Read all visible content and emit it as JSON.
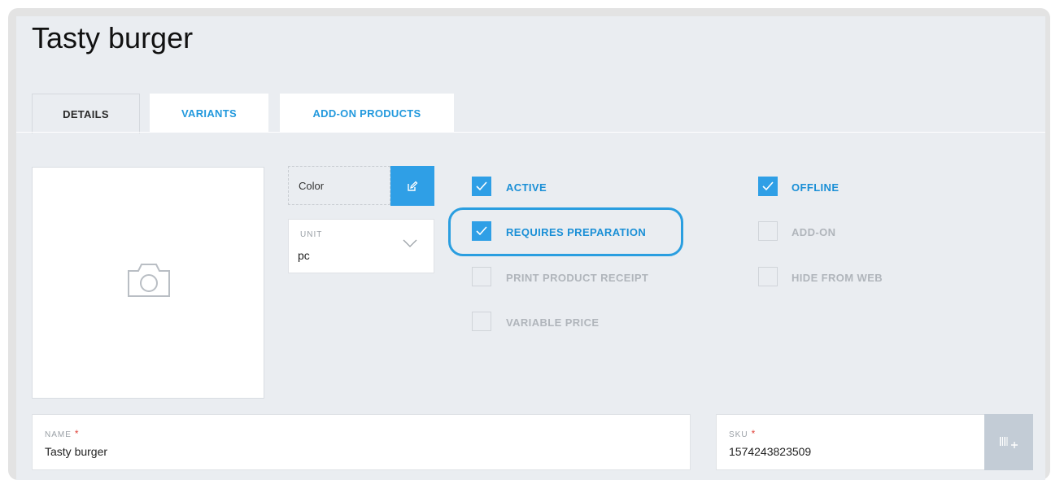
{
  "product": {
    "title": "Tasty burger"
  },
  "tabs": [
    {
      "label": "DETAILS",
      "active": true
    },
    {
      "label": "VARIANTS",
      "active": false
    },
    {
      "label": "ADD-ON PRODUCTS",
      "active": false
    }
  ],
  "color_field": {
    "label": "Color"
  },
  "unit_field": {
    "label": "UNIT",
    "value": "pc"
  },
  "checkboxes": {
    "active": {
      "label": "ACTIVE",
      "checked": true
    },
    "requires_preparation": {
      "label": "REQUIRES PREPARATION",
      "checked": true
    },
    "print_product_receipt": {
      "label": "PRINT PRODUCT RECEIPT",
      "checked": false
    },
    "variable_price": {
      "label": "VARIABLE PRICE",
      "checked": false
    },
    "offline": {
      "label": "OFFLINE",
      "checked": true
    },
    "add_on": {
      "label": "ADD-ON",
      "checked": false
    },
    "hide_from_web": {
      "label": "HIDE FROM WEB",
      "checked": false
    }
  },
  "name_field": {
    "label": "NAME",
    "required_mark": "*",
    "value": "Tasty burger"
  },
  "sku_field": {
    "label": "SKU",
    "required_mark": "*",
    "value": "1574243823509"
  },
  "colors": {
    "accent": "#2f9fe6",
    "highlight": "#2a9ee0",
    "required": "#e0433a"
  },
  "icons": {
    "image_placeholder": "camera-icon",
    "color_edit": "edit-icon",
    "unit_dropdown": "chevron-down-icon",
    "checked": "checkmark-icon",
    "sku_generate": "barcode-add-icon"
  }
}
